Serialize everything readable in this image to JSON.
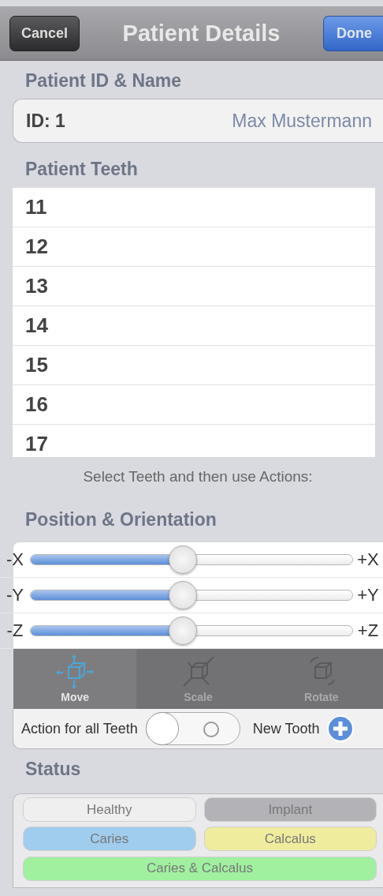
{
  "nav_bar": {
    "cancel": "Cancel",
    "title": "Patient Details",
    "done": "Done"
  },
  "patient_section": {
    "header": "Patient ID & Name",
    "id": "ID: 1",
    "name": "Max Mustermann"
  },
  "teeth_section": {
    "header": "Patient Teeth",
    "teeth": [
      "11",
      "12",
      "13",
      "14",
      "15",
      "16",
      "17"
    ],
    "caption": "Select Teeth and then use Actions:"
  },
  "position_section": {
    "header": "Position & Orientation",
    "sliders": [
      {
        "min_label": "-X",
        "max_label": "+X",
        "level": 0.47
      },
      {
        "min_label": "-Y",
        "max_label": "+Y",
        "level": 0.47
      },
      {
        "min_label": "-Z",
        "max_label": "+Z",
        "level": 0.47
      }
    ],
    "actions": [
      {
        "kind": "move",
        "label": "Move",
        "selected": true
      },
      {
        "kind": "scale",
        "label": "Scale",
        "selected": false
      },
      {
        "kind": "rotate",
        "label": "Rotate",
        "selected": false
      }
    ],
    "all_teeth": {
      "label": "Action for all Teeth",
      "on": false
    },
    "new_tooth": "New Tooth"
  },
  "status_section": {
    "header": "Status",
    "statuses": [
      {
        "label": "Healthy",
        "color": "#efefef"
      },
      {
        "label": "Implant",
        "color": "#b3b2b6"
      },
      {
        "label": "Caries",
        "color": "#a0cdee"
      },
      {
        "label": "Calcalus",
        "color": "#efec9e"
      },
      {
        "label": "Caries & Calcalus",
        "color": "#a0f0a0"
      }
    ]
  }
}
